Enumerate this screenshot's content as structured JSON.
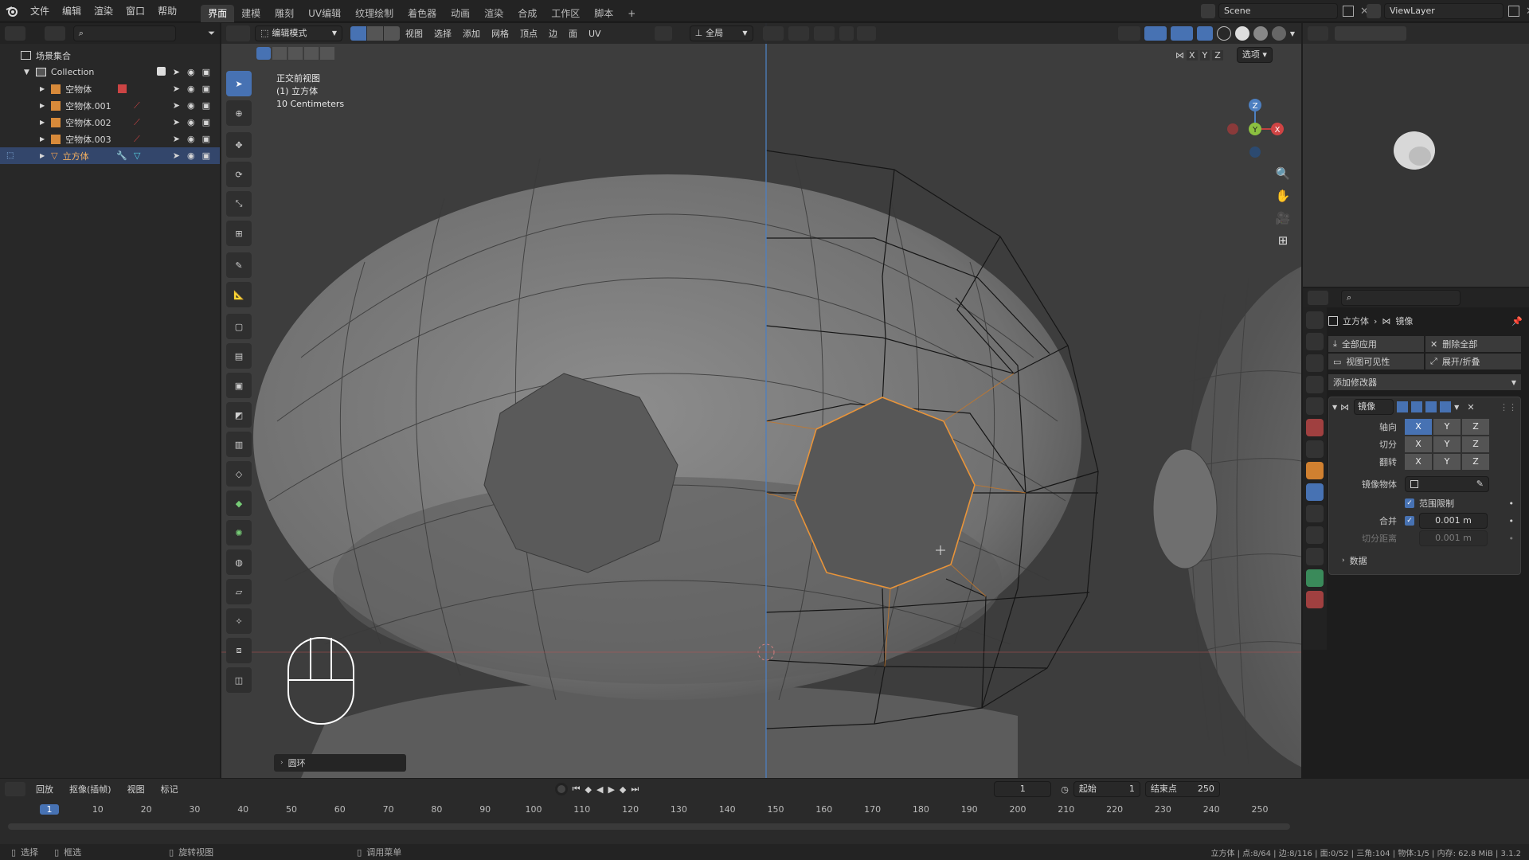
{
  "topbar": {
    "menus": [
      "文件",
      "编辑",
      "渲染",
      "窗口",
      "帮助"
    ],
    "workspaces": [
      "界面",
      "建模",
      "雕刻",
      "UV编辑",
      "纹理绘制",
      "着色器",
      "动画",
      "渲染",
      "合成",
      "工作区",
      "脚本"
    ],
    "active_workspace_index": 0,
    "add_tab": "+",
    "scene_name": "Scene",
    "view_layer_name": "ViewLayer"
  },
  "outliner": {
    "root_label": "场景集合",
    "collection_label": "Collection",
    "items": [
      {
        "label": "空物体"
      },
      {
        "label": "空物体.001"
      },
      {
        "label": "空物体.002"
      },
      {
        "label": "空物体.003"
      },
      {
        "label": "立方体"
      }
    ]
  },
  "viewport": {
    "mode_label": "编辑模式",
    "menus": [
      "视图",
      "选择",
      "添加",
      "网格",
      "顶点",
      "边",
      "面",
      "UV"
    ],
    "transform_orientation": "全局",
    "options_label": "选项",
    "axes_labels": [
      "X",
      "Y",
      "Z"
    ],
    "overlay_text": {
      "view_name": "正交前视图",
      "object_name": "(1) 立方体",
      "scale": "10 Centimeters"
    },
    "last_op_panel": "圆环",
    "gizmo_axes": {
      "x": "X",
      "y": "Y",
      "z": "Z"
    }
  },
  "properties": {
    "breadcrumb": [
      "立方体",
      "镜像"
    ],
    "apply_all": "全部应用",
    "delete_all": "删除全部",
    "viewport_vis": "视图可见性",
    "expand_collapse": "展开/折叠",
    "add_modifier": "添加修改器",
    "modifier_name": "镜像",
    "rows": {
      "axis": "轴向",
      "bisect": "切分",
      "flip": "翻转",
      "mirror_object": "镜像物体",
      "clipping": "范围限制",
      "merge": "合并",
      "merge_value": "0.001 m",
      "bisect_distance": "切分距离",
      "bisect_value": "0.001 m",
      "data": "数据"
    },
    "axis_on": {
      "axis": "X",
      "bisect": "",
      "flip": ""
    }
  },
  "timeline": {
    "menus": [
      "回放",
      "抠像(插帧)",
      "视图",
      "标记"
    ],
    "current_frame": "1",
    "start_label": "起始",
    "start": "1",
    "end_label": "结束点",
    "end": "250",
    "ruler": [
      "1",
      "10",
      "20",
      "30",
      "40",
      "50",
      "60",
      "70",
      "80",
      "90",
      "100",
      "110",
      "120",
      "130",
      "140",
      "150",
      "160",
      "170",
      "180",
      "190",
      "200",
      "210",
      "220",
      "230",
      "240",
      "250"
    ]
  },
  "statusbar": {
    "select": "选择",
    "box_select": "框选",
    "rotate_view": "旋转视图",
    "call_menu": "调用菜单",
    "stats": "立方体 | 点:8/64 | 边:8/116 | 面:0/52 | 三角:104 | 物体:1/5 | 内存: 62.8 MiB | 3.1.2"
  },
  "colors": {
    "accent": "#4772b3",
    "selection_orange": "#e8943a",
    "header_bg": "#232323",
    "panel_bg": "#2b2b2b"
  }
}
